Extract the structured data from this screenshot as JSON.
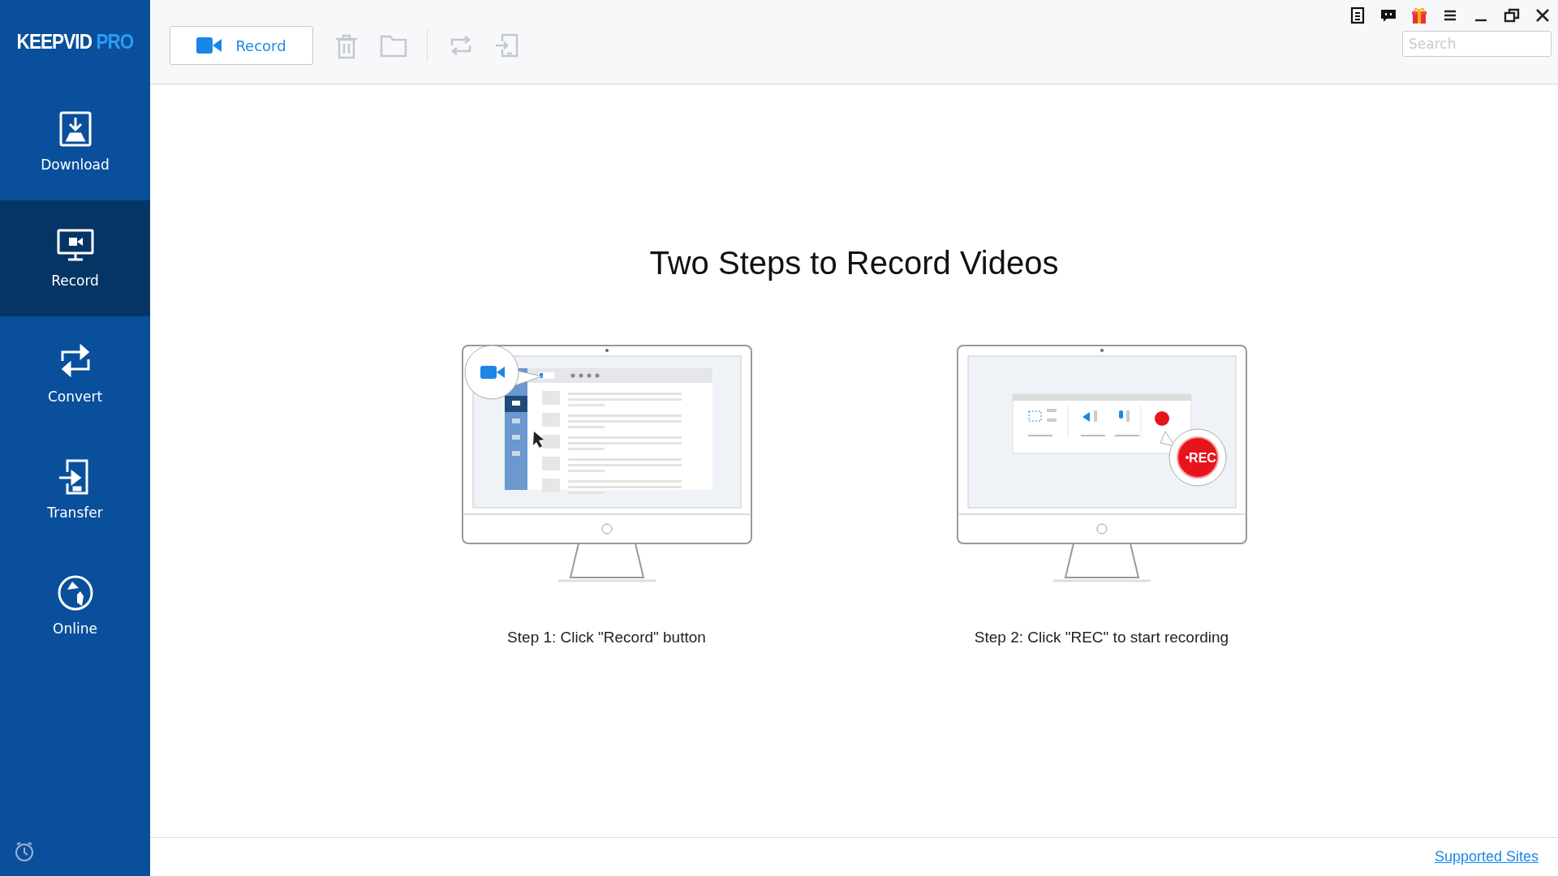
{
  "logo": {
    "primary": "KEEPVID",
    "accent": "PRO"
  },
  "sidebar": {
    "items": [
      {
        "kind": "download",
        "label": "Download",
        "selected": false
      },
      {
        "kind": "record",
        "label": "Record",
        "selected": true
      },
      {
        "kind": "convert",
        "label": "Convert",
        "selected": false
      },
      {
        "kind": "transfer",
        "label": "Transfer",
        "selected": false
      },
      {
        "kind": "online",
        "label": "Online",
        "selected": false
      }
    ]
  },
  "toolbar": {
    "record_button": "Record",
    "tools": [
      {
        "kind": "delete",
        "disabled": true
      },
      {
        "kind": "folder",
        "disabled": true
      },
      {
        "kind": "separator"
      },
      {
        "kind": "convert",
        "disabled": true
      },
      {
        "kind": "transfer",
        "disabled": true
      }
    ]
  },
  "window_controls": [
    {
      "kind": "notes"
    },
    {
      "kind": "feedback"
    },
    {
      "kind": "gift"
    },
    {
      "kind": "menu"
    },
    {
      "kind": "minimize"
    },
    {
      "kind": "restore"
    },
    {
      "kind": "close"
    }
  ],
  "search": {
    "placeholder": "Search"
  },
  "main": {
    "title": "Two Steps to Record Videos",
    "steps": [
      {
        "kind": "record",
        "label": "Step 1: Click \"Record\" button"
      },
      {
        "kind": "rec",
        "label": "Step 2: Click \"REC\" to start recording",
        "badge": "REC"
      }
    ]
  },
  "footer": {
    "link": "Supported Sites"
  }
}
